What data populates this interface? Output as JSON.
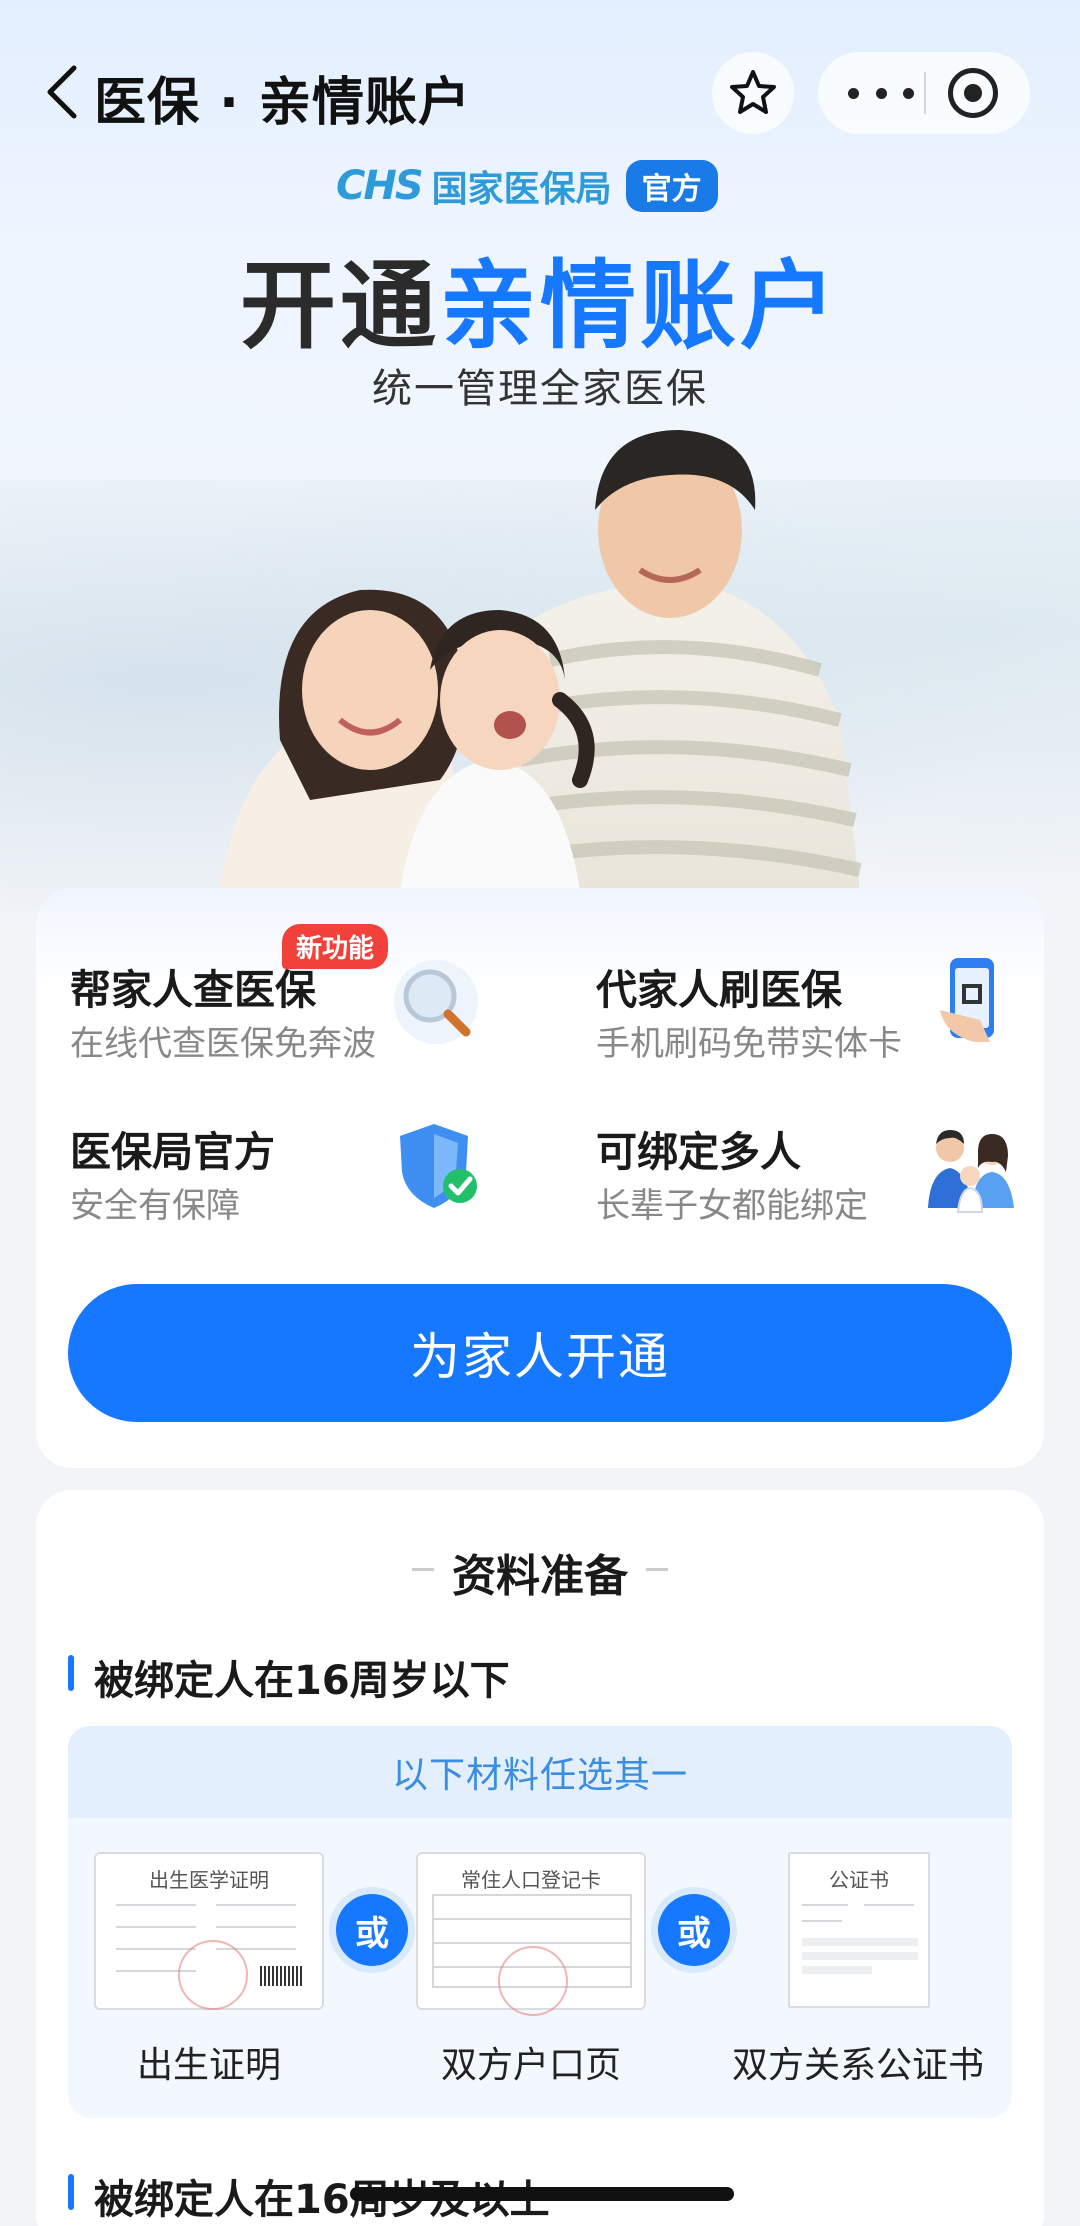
{
  "nav": {
    "title": "医保 · 亲情账户"
  },
  "brand": {
    "logo_text": "CHS",
    "bureau": "国家医保局",
    "badge": "官方"
  },
  "headline": {
    "part1": "开通",
    "part2": "亲情账户",
    "subtitle": "统一管理全家医保"
  },
  "features": [
    {
      "title": "帮家人查医保",
      "subtitle": "在线代查医保免奔波",
      "icon": "magnifier-icon"
    },
    {
      "title": "代家人刷医保",
      "subtitle": "手机刷码免带实体卡",
      "icon": "phone-qr-icon"
    },
    {
      "title": "医保局官方",
      "subtitle": "安全有保障",
      "icon": "shield-check-icon"
    },
    {
      "title": "可绑定多人",
      "subtitle": "长辈子女都能绑定",
      "icon": "family-icon"
    }
  ],
  "new_badge": "新功能",
  "open_button": "为家人开通",
  "documents": {
    "section_title": "资料准备",
    "group1_label": "被绑定人在16周岁以下",
    "choose_hint": "以下材料任选其一",
    "or_label": "或",
    "items": [
      {
        "label": "出生证明",
        "doc_title": "出生医学证明"
      },
      {
        "label": "双方户口页",
        "doc_title": "常住人口登记卡"
      },
      {
        "label": "双方关系公证书",
        "doc_title": "公证书"
      }
    ],
    "group2_label": "被绑定人在16周岁及以上"
  },
  "colors": {
    "primary": "#1677ff",
    "badge_red": "#f2413a",
    "brand_blue": "#2e9ad9"
  }
}
